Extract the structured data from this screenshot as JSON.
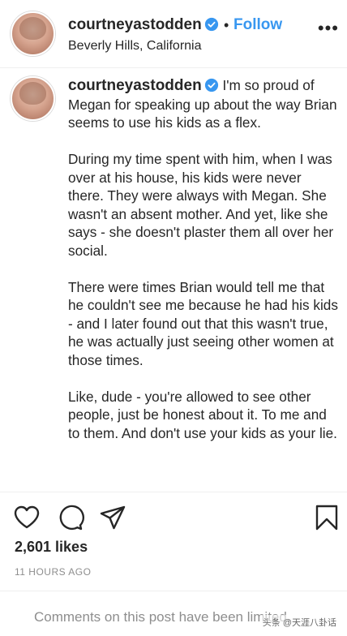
{
  "post": {
    "username": "courtneyastodden",
    "location": "Beverly Hills, California",
    "follow_label": "Follow",
    "separator": "•",
    "more_label": "•••"
  },
  "caption": {
    "username": "courtneyastodden",
    "paragraphs": [
      "I'm so proud of Megan for speaking up about the way Brian seems to use his kids as a flex.",
      "During my time spent with him, when I was over at his house, his kids were never there. They were always with Megan. She wasn't an absent mother. And yet, like she says - she doesn't plaster them all over her social.",
      "There were times Brian would tell me that he couldn't see me because he had his kids - and I later found out that this wasn't true, he was actually just seeing other women at those times.",
      "Like, dude - you're allowed to see other people, just be honest about it. To me and to them. And don't use your kids as your lie."
    ]
  },
  "engagement": {
    "likes": "2,601 likes",
    "timestamp": "11 HOURS AGO",
    "comments_notice": "Comments on this post have been limited."
  },
  "icons": {
    "like": "heart-icon",
    "comment": "comment-icon",
    "share": "share-icon",
    "save": "bookmark-icon",
    "verified": "verified-badge-icon",
    "more": "more-options-icon"
  },
  "colors": {
    "link_blue": "#3897f0",
    "text": "#262626",
    "muted": "#8e8e8e"
  },
  "watermark": "头条 @天涯八卦话"
}
